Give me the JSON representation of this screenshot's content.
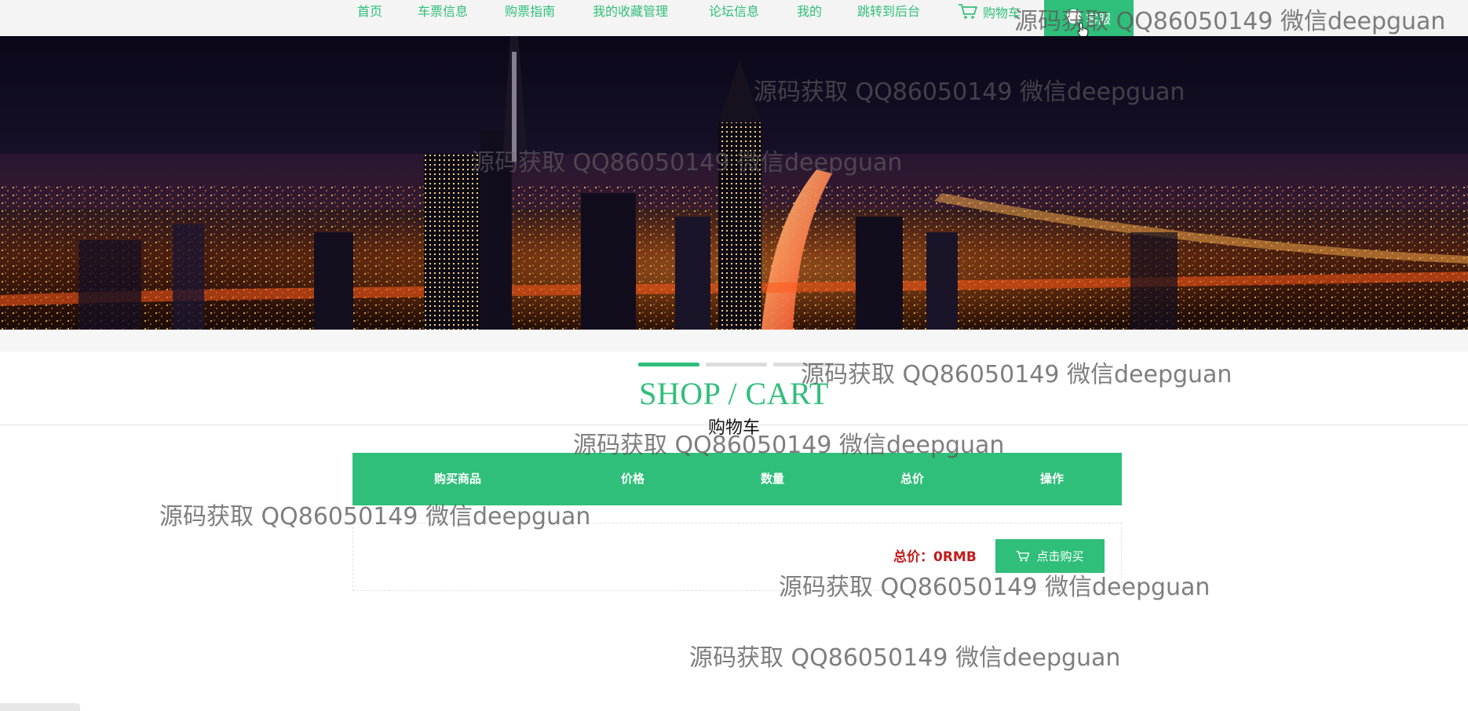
{
  "nav": {
    "items": [
      {
        "label": "首页"
      },
      {
        "label": "车票信息"
      },
      {
        "label": "购票指南"
      },
      {
        "label": "我的收藏管理"
      },
      {
        "label": "论坛信息"
      },
      {
        "label": "我的"
      },
      {
        "label": "跳转到后台"
      }
    ],
    "cart_label": "购物车",
    "service_label": "客服",
    "accent_color": "#2fbf7a"
  },
  "banner": {
    "description_icon": "night-city-banner"
  },
  "section": {
    "title": "SHOP / CART",
    "subtitle": "购物车"
  },
  "cart": {
    "columns": [
      "购买商品",
      "价格",
      "数量",
      "总价",
      "操作"
    ],
    "rows": [],
    "total_label": "总价：0RMB",
    "buy_label": "点击购买"
  },
  "watermark": {
    "text": "源码获取 QQ86050149 微信deepguan"
  }
}
